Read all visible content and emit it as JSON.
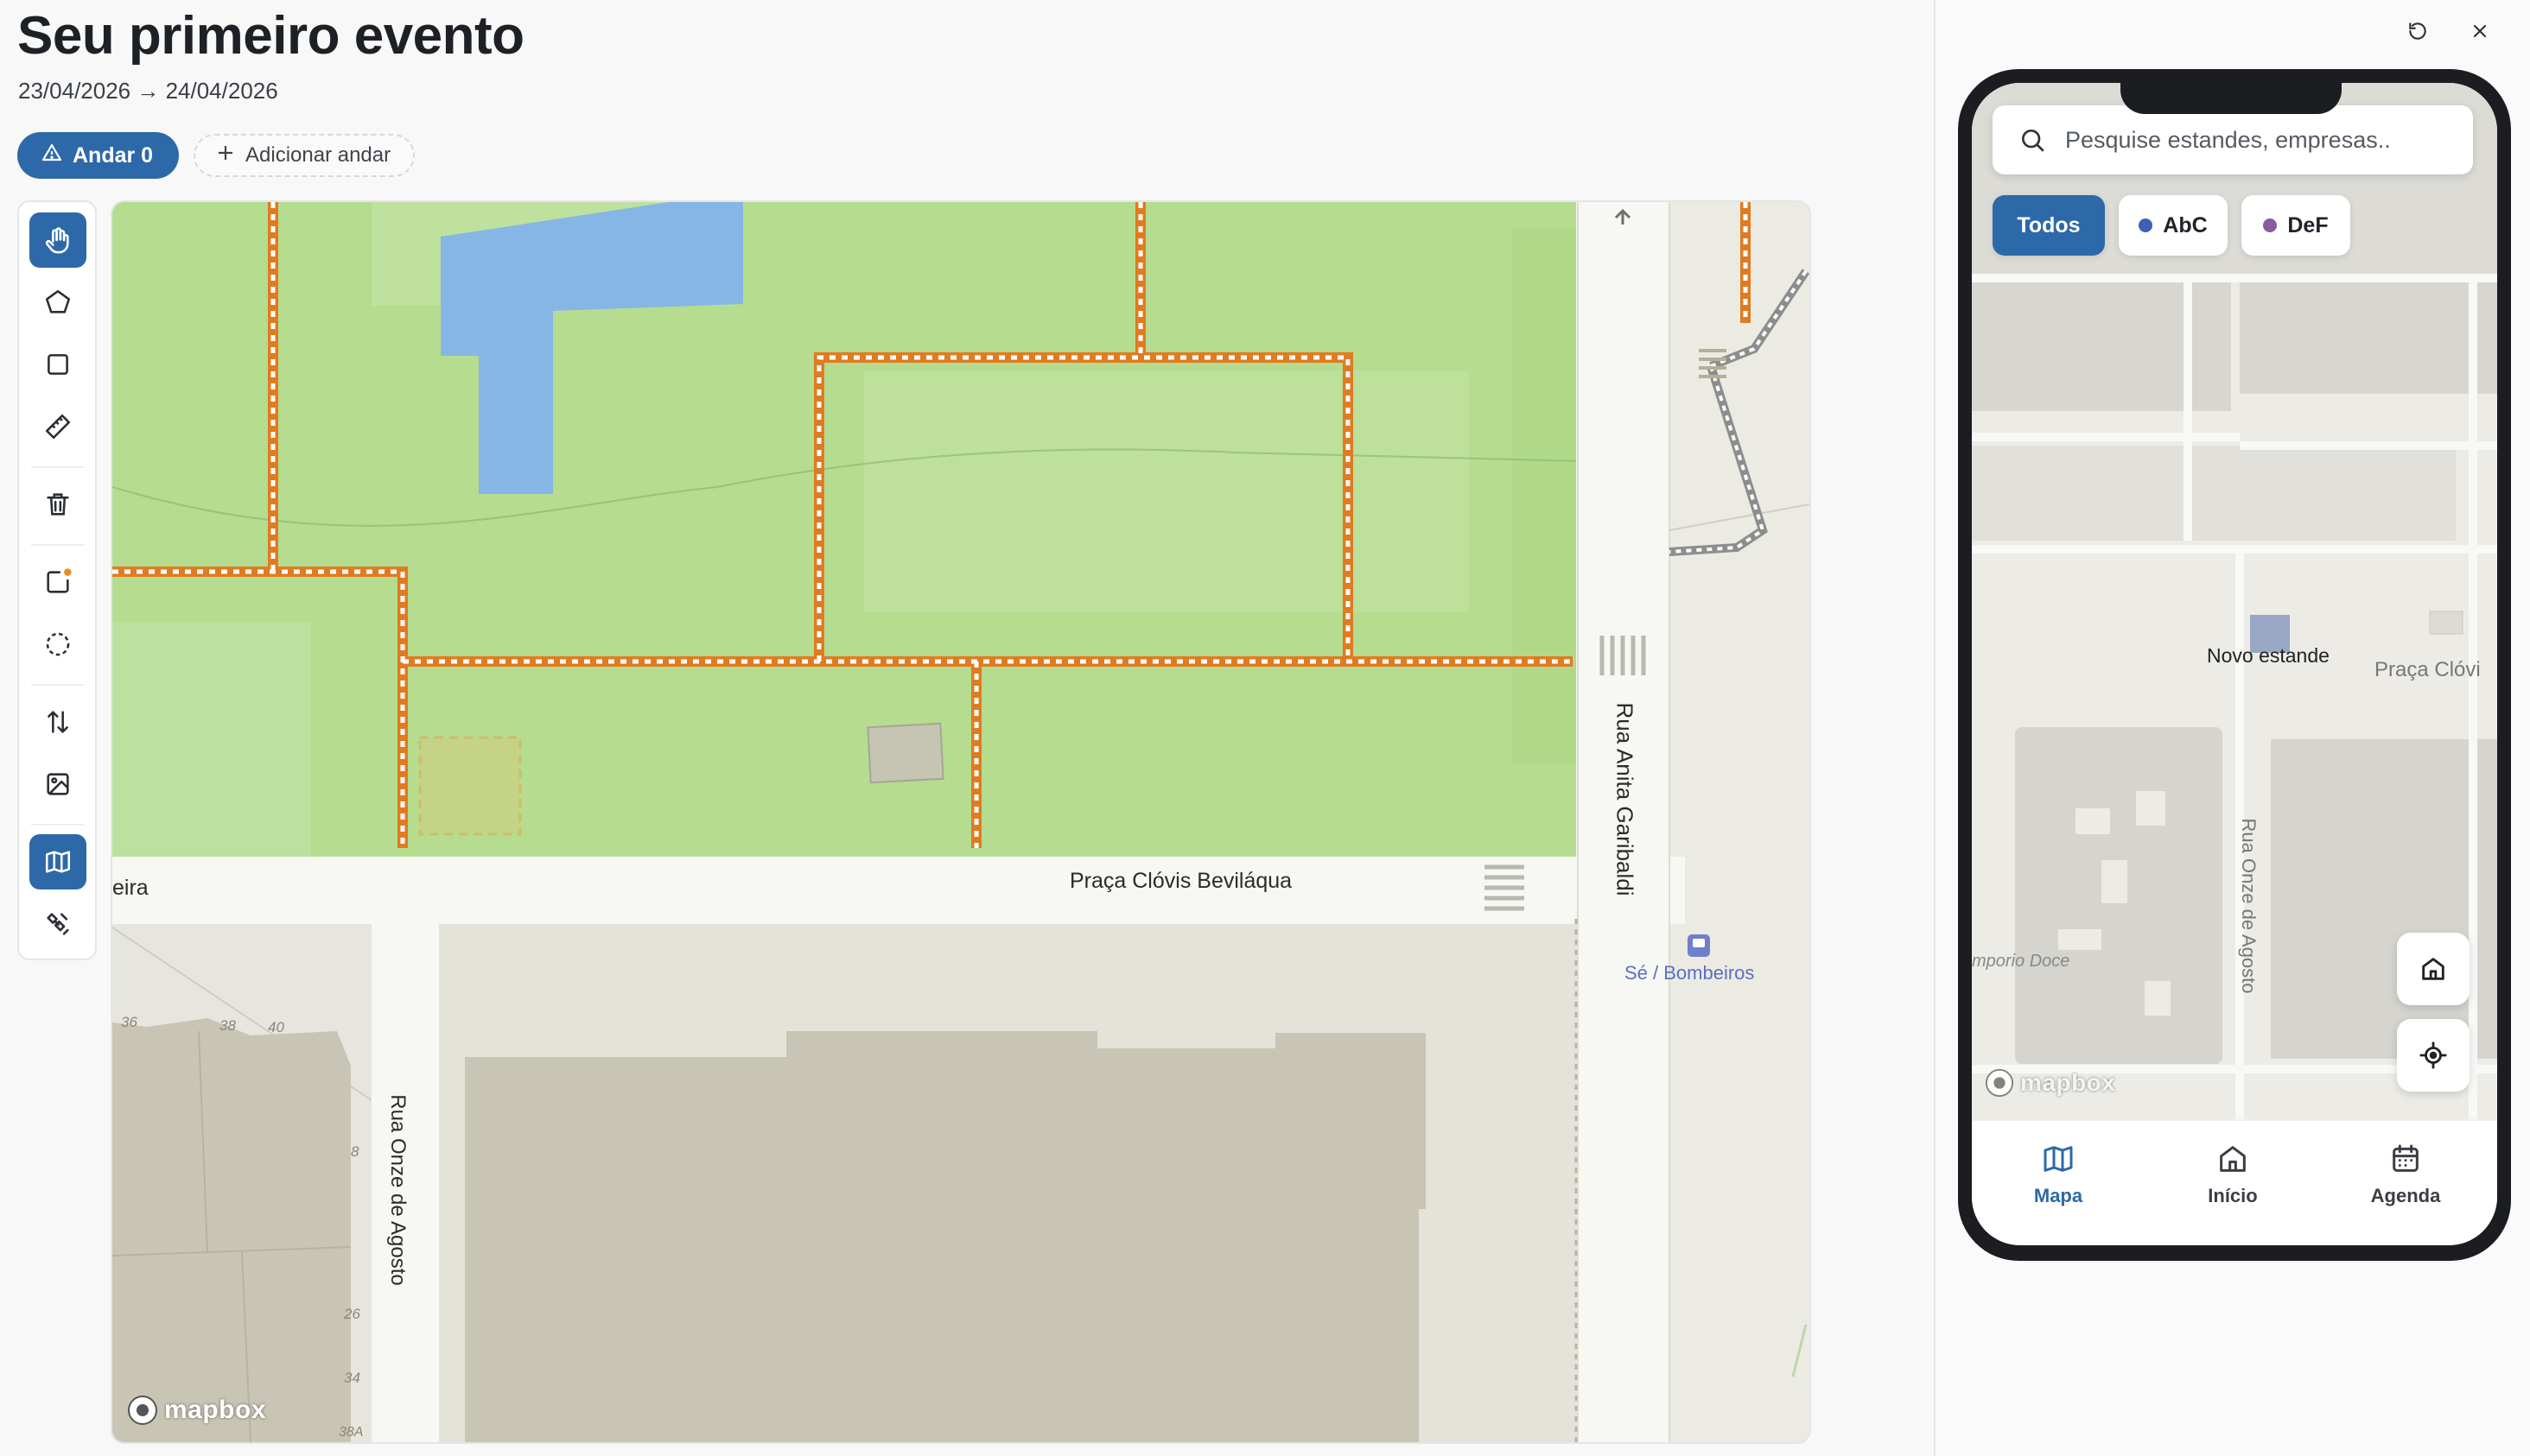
{
  "page": {
    "title": "Seu primeiro evento",
    "dates": "23/04/2026 → 24/04/2026",
    "floor_button": "Andar 0",
    "add_floor": "Adicionar andar"
  },
  "toolbar": {
    "tools": [
      {
        "name": "hand-tool-button",
        "icon": "hand-icon",
        "active": true
      },
      {
        "name": "polygon-tool-button",
        "icon": "pentagon-icon",
        "active": false
      },
      {
        "name": "rectangle-tool-button",
        "icon": "square-icon",
        "active": false
      },
      {
        "name": "ruler-tool-button",
        "icon": "ruler-icon",
        "active": false
      },
      {
        "name": "delete-tool-button",
        "icon": "trash-icon",
        "active": false
      },
      {
        "name": "booth-tool-button",
        "icon": "booth-icon",
        "active": false
      },
      {
        "name": "circle-tool-button",
        "icon": "circle-dashed-icon",
        "active": false
      },
      {
        "name": "sort-tool-button",
        "icon": "arrows-updown-icon",
        "active": false
      },
      {
        "name": "image-tool-button",
        "icon": "image-icon",
        "active": false
      },
      {
        "name": "map-tool-button",
        "icon": "map-icon",
        "active": true
      },
      {
        "name": "satellite-tool-button",
        "icon": "satellite-icon",
        "active": false
      }
    ]
  },
  "map": {
    "labels": {
      "square": "Praça Clóvis Beviláqua",
      "street_left_fragment": "eira",
      "street_vertical_1": "Rua Onze de Agosto",
      "street_vertical_2": "Rua Anita Garibaldi",
      "bus_stop": "Sé / Bombeiros",
      "house_numbers": [
        "36",
        "38",
        "40",
        "8",
        "26",
        "34",
        "38A"
      ]
    },
    "logo": "mapbox",
    "colors": {
      "park": "#b4dc8e",
      "water": "#86b6e6",
      "booth": "#e07b21",
      "building": "#c9c5b4",
      "street": "#f5f5f2"
    }
  },
  "preview": {
    "search_placeholder": "Pesquise estandes, empresas..",
    "chips": [
      {
        "label": "Todos",
        "active": true
      },
      {
        "label": "AbC",
        "dot": "#3f5fb5"
      },
      {
        "label": "DeF",
        "dot": "#8a5a9e"
      }
    ],
    "map_labels": {
      "booth": "Novo estande",
      "square": "Praça Clóvi",
      "street": "Rua Onze de Agosto",
      "shop": "mporio Doce"
    },
    "logo": "mapbox",
    "tabs": [
      {
        "label": "Mapa",
        "icon": "map-icon",
        "active": true
      },
      {
        "label": "Início",
        "icon": "home-icon",
        "active": false
      },
      {
        "label": "Agenda",
        "icon": "calendar-icon",
        "active": false
      }
    ]
  }
}
